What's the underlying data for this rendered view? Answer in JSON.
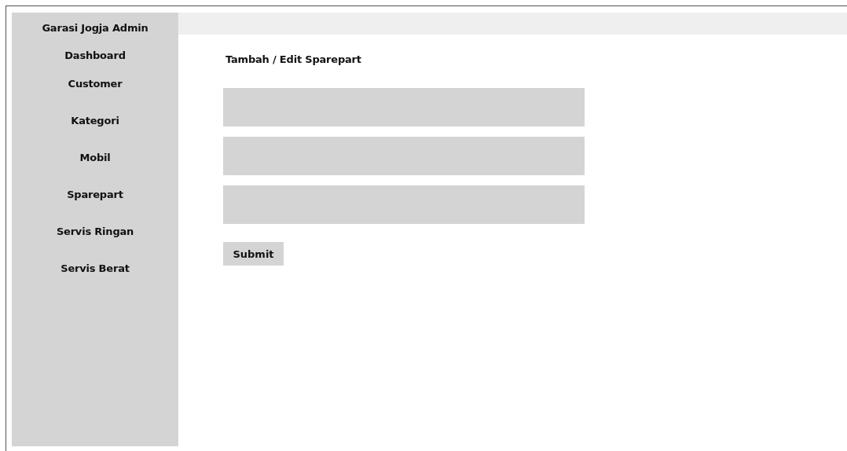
{
  "sidebar": {
    "brand": "Garasi Jogja Admin",
    "items": [
      {
        "label": "Dashboard"
      },
      {
        "label": "Customer"
      },
      {
        "label": "Kategori"
      },
      {
        "label": "Mobil"
      },
      {
        "label": "Sparepart"
      },
      {
        "label": "Servis Ringan"
      },
      {
        "label": "Servis Berat"
      }
    ]
  },
  "form": {
    "title": "Tambah / Edit Sparepart",
    "fields": [
      {
        "kind": "text"
      },
      {
        "kind": "text"
      },
      {
        "kind": "text"
      }
    ],
    "submit": "Submit"
  }
}
